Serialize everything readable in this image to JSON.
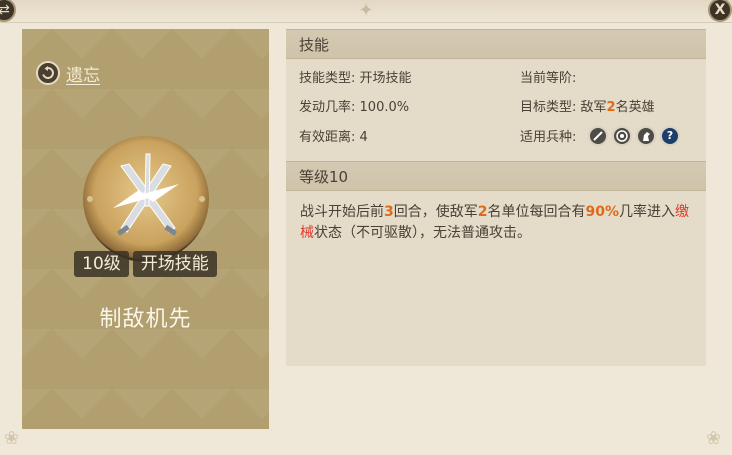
{
  "window": {
    "left_corner_icon": "swap-icon",
    "close_icon": "close-icon",
    "close_glyph": "X"
  },
  "card": {
    "back_label": "遗忘",
    "level_badge": "10级",
    "type_badge": "开场技能",
    "skill_name": "制敌机先",
    "emblem_icon": "crossed-swords-icon"
  },
  "skill": {
    "header": "技能",
    "type_label": "技能类型:",
    "type_value": "开场技能",
    "rank_label": "当前等阶:",
    "rank_value": "",
    "rate_label": "发动几率:",
    "rate_value": "100.0%",
    "target_label": "目标类型:",
    "target_pre": "敌军",
    "target_num": "2",
    "target_post": "名英雄",
    "range_label": "有效距离:",
    "range_value": "4",
    "troops_label": "适用兵种:",
    "troops": [
      "infantry-icon",
      "archer-icon",
      "cavalry-icon",
      "unknown-icon"
    ],
    "troop_q": "?"
  },
  "level": {
    "header": "等级10",
    "desc_1": "战斗开始后前",
    "desc_n1": "3",
    "desc_2": "回合，使敌军",
    "desc_n2": "2",
    "desc_3": "名单位每回合有",
    "desc_n3": "90%",
    "desc_4": "几率进入",
    "desc_red": "缴械",
    "desc_5": "状态（不可驱散），无法普通攻击。"
  },
  "colors": {
    "accent": "#e06a1a",
    "status_red": "#e03a2a",
    "card_bg": "#b19f6f"
  }
}
